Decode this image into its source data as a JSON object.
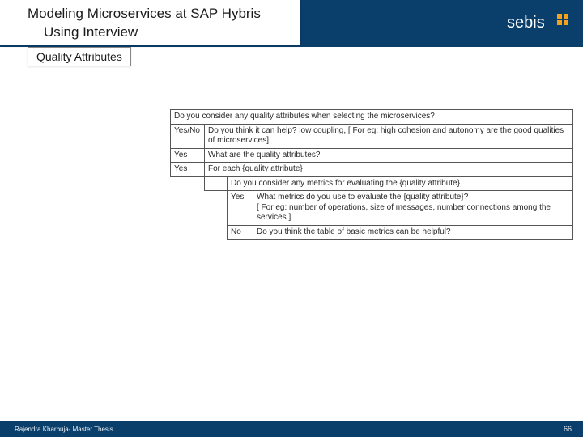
{
  "header": {
    "title_line1": "Modeling Microservices at SAP Hybris",
    "title_line2": "Using Interview",
    "logo_name": "sebis"
  },
  "tab": {
    "label": "Quality Attributes"
  },
  "table": {
    "rows": {
      "r1_q": "Do you consider any quality attributes when selecting the microservices?",
      "r2_col1": "Yes/No",
      "r2_q": "Do you think it can help? low coupling, [ For eg: high cohesion and autonomy are the good qualities of microservices]",
      "r3_col1": "Yes",
      "r3_q": "What are the quality attributes?",
      "r4_col1": "Yes",
      "r4_q": "For each {quality attribute}",
      "r5_q": "Do you consider any metrics for evaluating the {quality attribute}",
      "r6_col3": "Yes",
      "r6_q": "What metrics do you use to evaluate the {quality attribute}?\n[ For eg: number of operations, size of messages, number connections among the services ]",
      "r7_col3": "No",
      "r7_q": "Do you think the table of basic metrics can be helpful?"
    }
  },
  "footer": {
    "author_text": "Rajendra Kharbuja- Master Thesis",
    "page_number": "66"
  }
}
